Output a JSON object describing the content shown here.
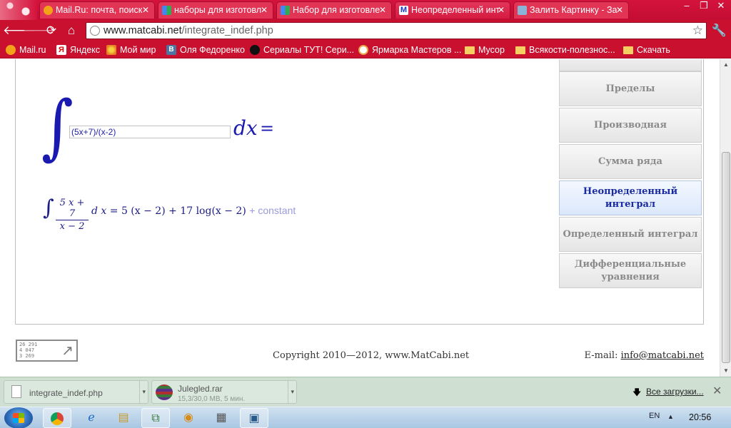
{
  "browser": {
    "tabs": [
      {
        "title": "Mail.Ru: почта, поиск",
        "icon": "mailru-favicon",
        "active": false
      },
      {
        "title": "наборы для изготовл",
        "icon": "google-favicon",
        "active": false
      },
      {
        "title": "Набор для изготовле",
        "icon": "google-favicon",
        "active": false
      },
      {
        "title": "Неопределенный инт",
        "icon": "matcabi-favicon",
        "active": true
      },
      {
        "title": "Залить Картинку - За",
        "icon": "image-host-favicon",
        "active": false
      }
    ],
    "url_host": "www.matcabi.net",
    "url_path": "/integrate_indef.php",
    "bookmarks": [
      {
        "label": "Mail.ru",
        "icon": "mailru-icon"
      },
      {
        "label": "Яндекс",
        "icon": "yandex-icon"
      },
      {
        "label": "Мой мир",
        "icon": "moimir-icon"
      },
      {
        "label": "Оля Федоренко",
        "icon": "vk-icon"
      },
      {
        "label": "Сериалы ТУТ! Сери...",
        "icon": "cat-icon"
      },
      {
        "label": "Ярмарка Мастеров ...",
        "icon": "yarmarka-icon"
      },
      {
        "label": "Мусор",
        "icon": "folder-icon"
      },
      {
        "label": "Всякости-полезнос...",
        "icon": "folder-icon"
      },
      {
        "label": "Скачать",
        "icon": "folder-icon"
      }
    ]
  },
  "integral": {
    "input_value": "(5x+7)/(x-2)",
    "dx_label": "dx",
    "equals": "="
  },
  "result": {
    "numerator": "5 x + 7",
    "denominator": "x − 2",
    "dx": "d x",
    "eq": "=",
    "term1": "5 (x − 2)",
    "plus": "+",
    "term2": "17 log(x − 2)",
    "constant": "+ constant"
  },
  "menu": [
    {
      "label": "Пределы",
      "active": false
    },
    {
      "label": "Производная",
      "active": false
    },
    {
      "label": "Сумма ряда",
      "active": false
    },
    {
      "label": "Неопределенный интеграл",
      "active": true
    },
    {
      "label": "Определенный интеграл",
      "active": false
    },
    {
      "label": "Дифференциальные уравнения",
      "active": false
    }
  ],
  "footer": {
    "counter_lines": [
      "26 291",
      "4 047",
      "3 269"
    ],
    "copyright": "Copyright 2010—2012, www.MatCabi.net",
    "email_label": "E-mail:",
    "email": "info@matcabi.net"
  },
  "downloads": [
    {
      "name": "integrate_indef.php",
      "status": "",
      "icon": "document-icon"
    },
    {
      "name": "Julegled.rar",
      "status": "15,3/30,0 MB, 5 мин.",
      "icon": "winrar-icon"
    }
  ],
  "downloads_all": "Все загрузки...",
  "taskbar": {
    "lang": "EN",
    "time": "20:56"
  },
  "colors": {
    "chrome_red": "#c9102f",
    "math_blue": "#1a1ab0",
    "menu_active": "#1a2aa0"
  }
}
